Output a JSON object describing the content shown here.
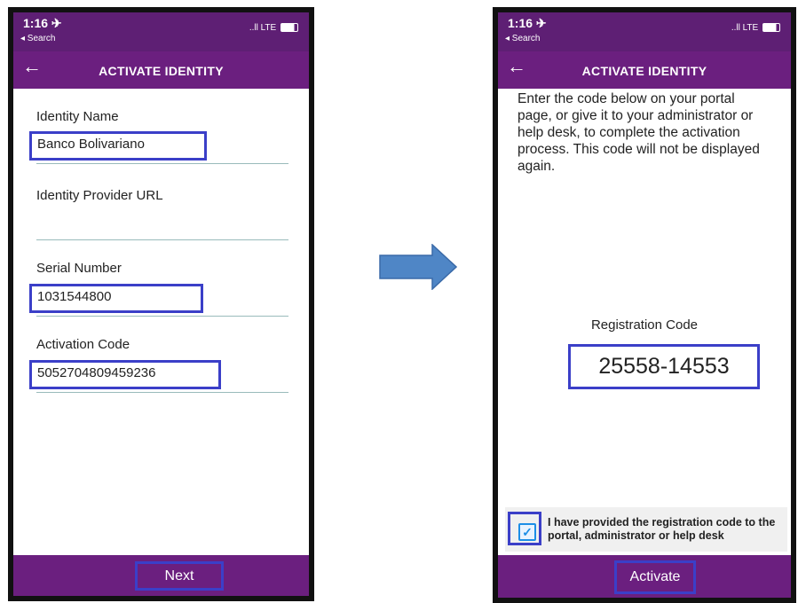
{
  "status_bar": {
    "time": "1:16 ✈",
    "back_label": "◂ Search",
    "network": "..ll LTE"
  },
  "left_screen": {
    "title": "ACTIVATE IDENTITY",
    "fields": [
      {
        "label": "Identity Name",
        "value": "Banco Bolivariano"
      },
      {
        "label": "Identity Provider URL",
        "value": ""
      },
      {
        "label": "Serial Number",
        "value": "1031544800"
      },
      {
        "label": "Activation Code",
        "value": "5052704809459236"
      }
    ],
    "next_label": "Next"
  },
  "right_screen": {
    "title": "ACTIVATE IDENTITY",
    "instructions": "Enter the code below on your portal page, or give it to your administrator or help desk, to complete the activation process. This code will not be displayed again.",
    "registration_label": "Registration Code",
    "registration_code": "25558-14553",
    "confirm_text": "I have provided the registration code to the portal, administrator or help desk",
    "confirm_checked": true,
    "activate_label": "Activate"
  },
  "colors": {
    "header": "#6b1f7f",
    "highlight": "#3b3fc8",
    "arrow": "#4f86c6"
  }
}
